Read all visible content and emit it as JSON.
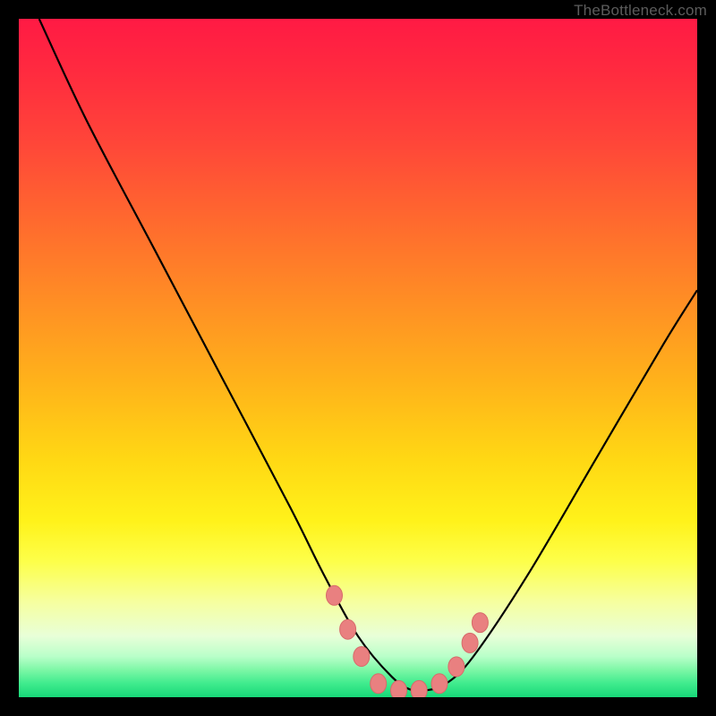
{
  "watermark": "TheBottleneck.com",
  "colors": {
    "frame": "#000000",
    "curve": "#000000",
    "marker_fill": "#e98080",
    "marker_stroke": "#d86a6a",
    "gradient_top": "#ff1a44",
    "gradient_bottom": "#17d878"
  },
  "chart_data": {
    "type": "line",
    "title": "",
    "xlabel": "",
    "ylabel": "",
    "xlim": [
      0,
      100
    ],
    "ylim": [
      0,
      100
    ],
    "grid": false,
    "legend": false,
    "series": [
      {
        "name": "bottleneck-curve",
        "x": [
          3,
          10,
          20,
          30,
          40,
          45,
          50,
          55,
          58,
          60,
          63,
          67,
          75,
          85,
          95,
          100
        ],
        "values": [
          100,
          85,
          66,
          47,
          28,
          18,
          9,
          3,
          1,
          1,
          2,
          6,
          18,
          35,
          52,
          60
        ]
      }
    ],
    "markers": [
      {
        "x": 46.5,
        "y": 15
      },
      {
        "x": 48.5,
        "y": 10
      },
      {
        "x": 50.5,
        "y": 6
      },
      {
        "x": 53,
        "y": 2
      },
      {
        "x": 56,
        "y": 1
      },
      {
        "x": 59,
        "y": 1
      },
      {
        "x": 62,
        "y": 2
      },
      {
        "x": 64.5,
        "y": 4.5
      },
      {
        "x": 66.5,
        "y": 8
      },
      {
        "x": 68,
        "y": 11
      }
    ],
    "annotations": []
  }
}
